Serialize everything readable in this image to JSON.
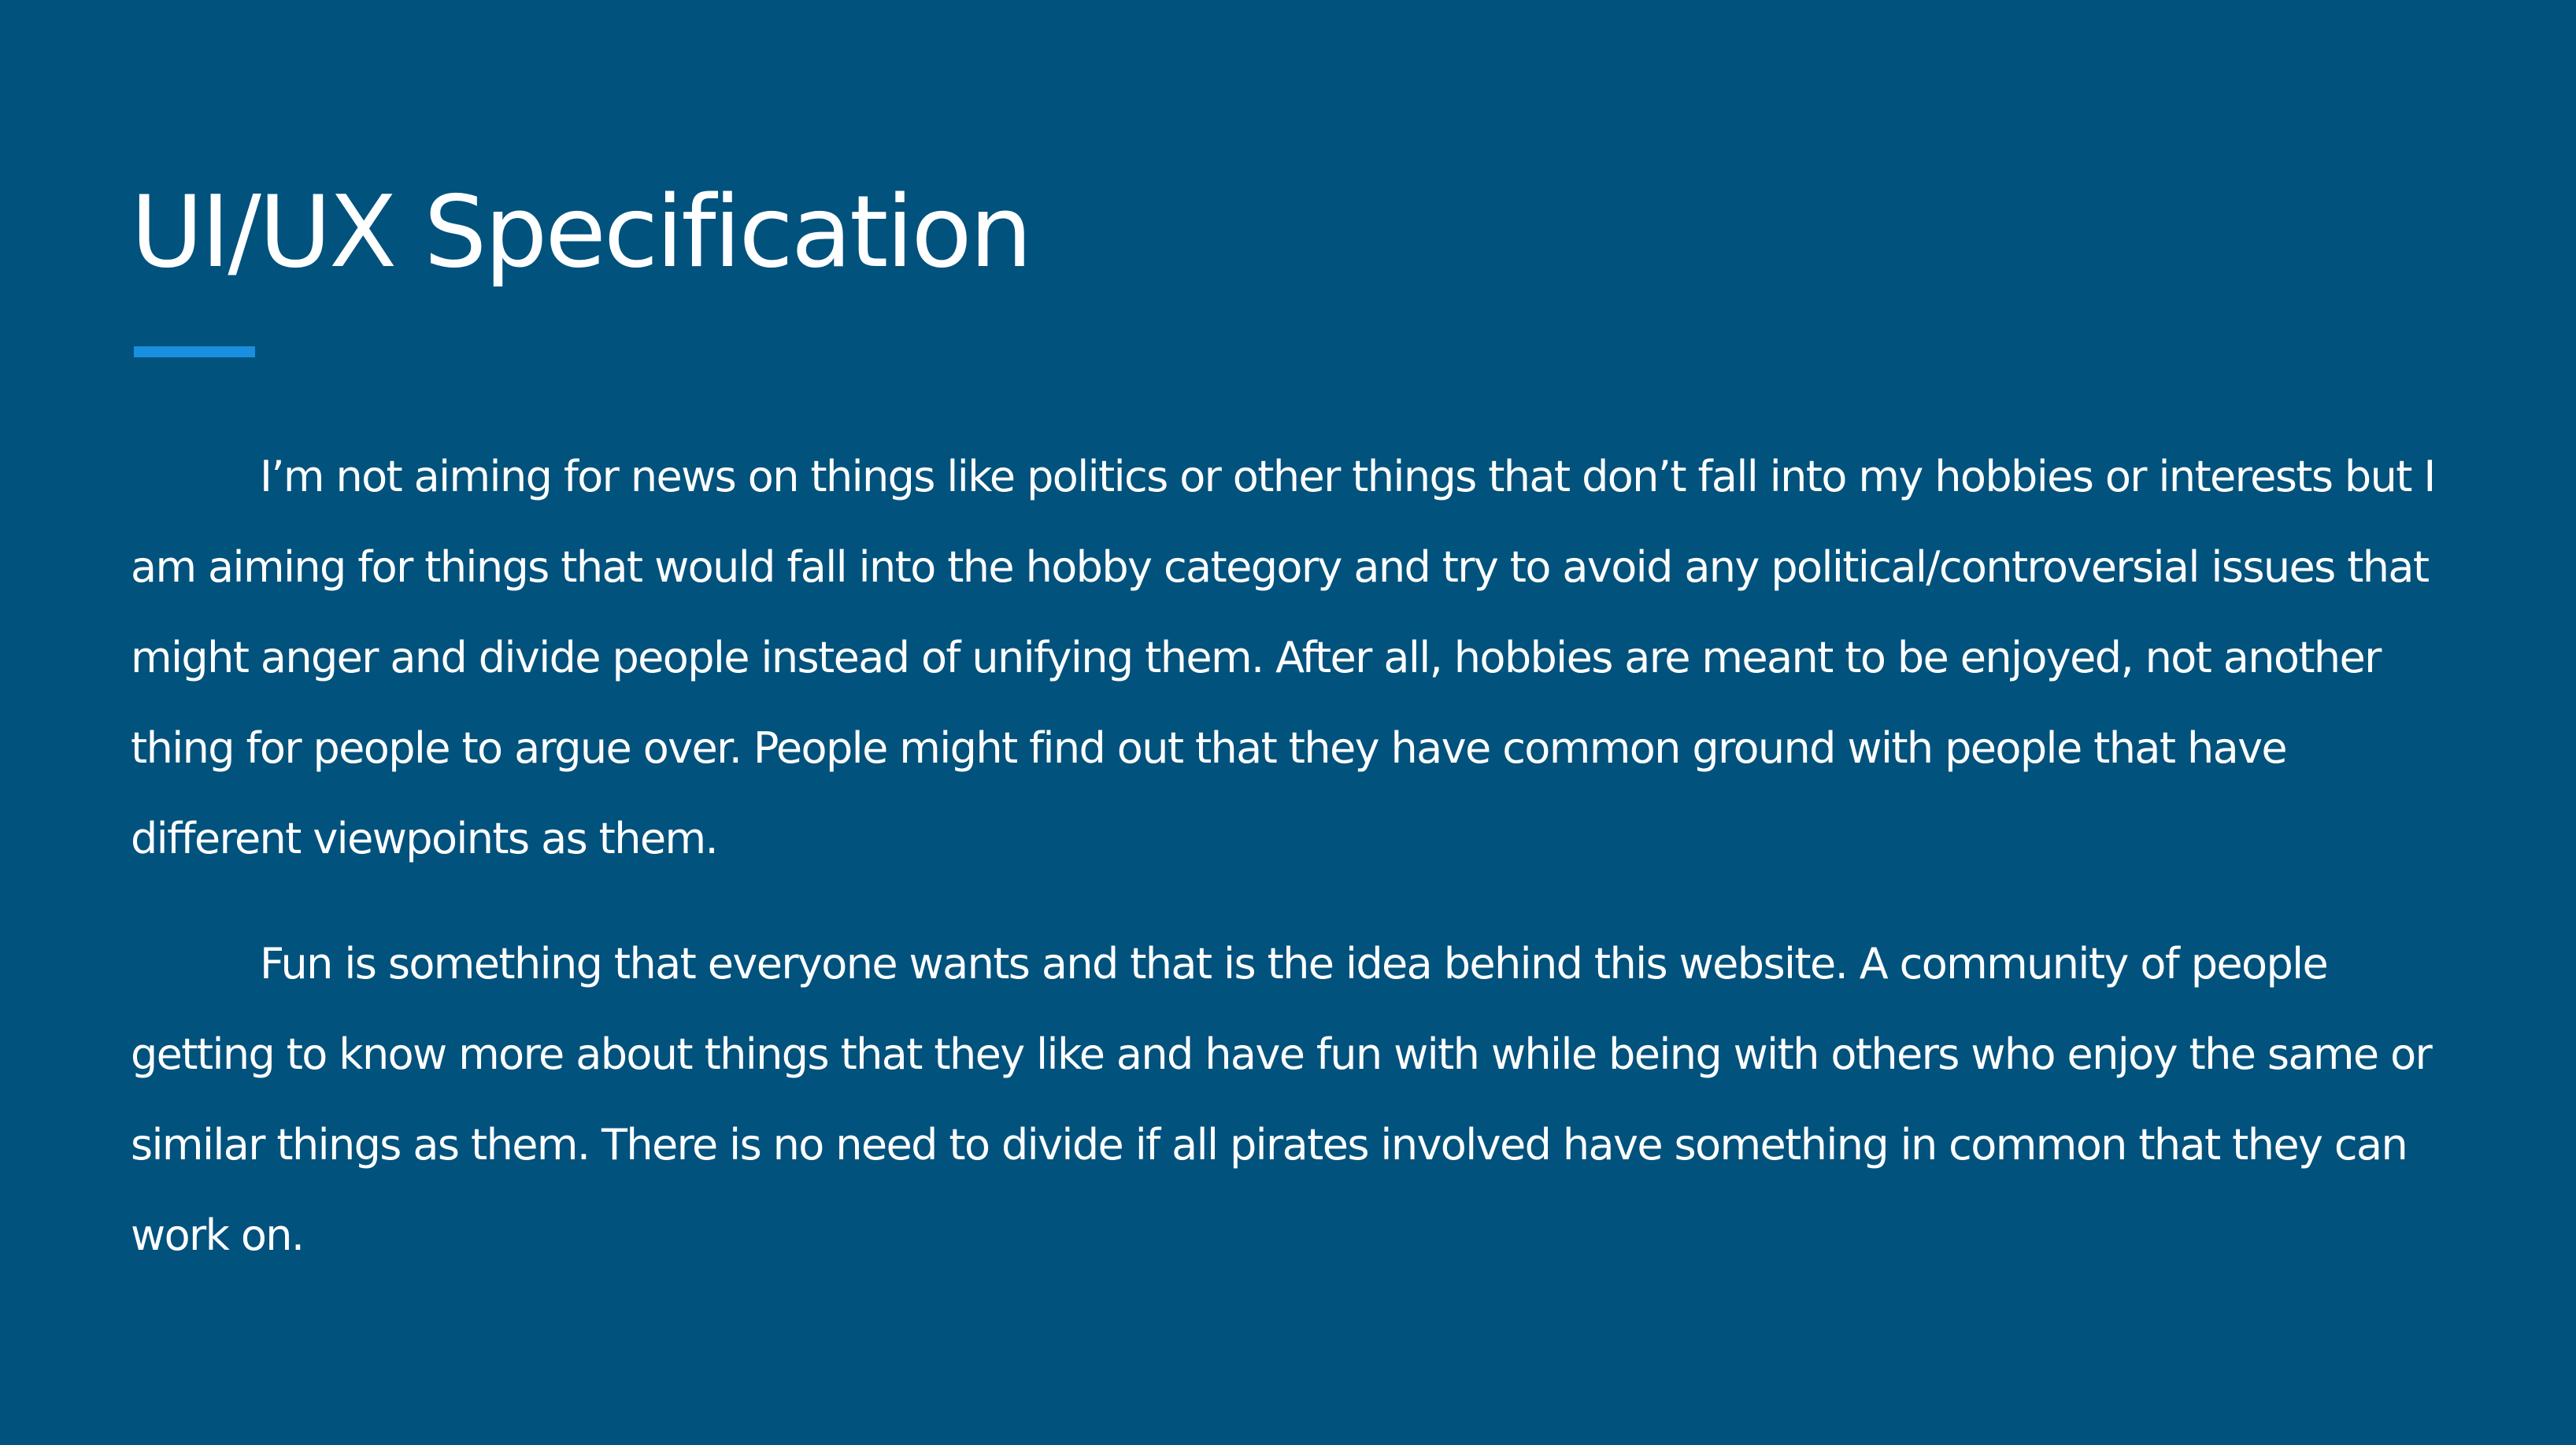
{
  "slide": {
    "title": "UI/UX Specification",
    "paragraphs": [
      "I’m not aiming for news on things like politics or other things that don’t fall into my hobbies or interests but I am aiming for things that would fall into the hobby category and try to avoid any political/controversial issues that might anger and divide people instead of unifying them. After all, hobbies are meant to be enjoyed, not another thing for people to argue over. People might find out that they have common ground with people that have different viewpoints as them.",
      "Fun is something that everyone wants and that is the idea behind this website. A community of people getting to know more about things that they like and have fun with while being with others who enjoy the same or similar things as them. There is no need to divide if all pirates involved have something in common that they can work on."
    ]
  },
  "colors": {
    "background": "#01527D",
    "text": "#FFFFFF",
    "accent": "#1A8FE0"
  }
}
